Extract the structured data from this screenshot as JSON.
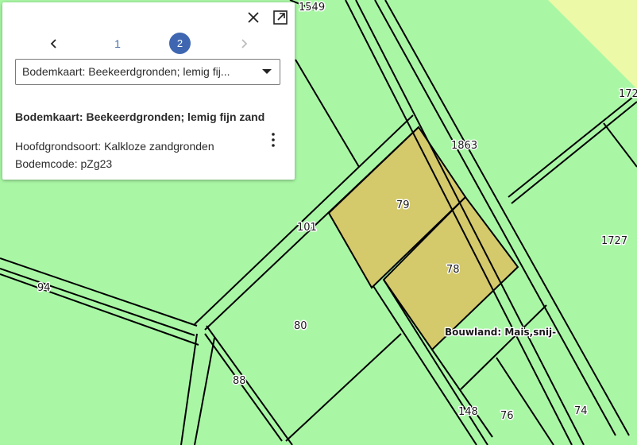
{
  "map": {
    "parcel_labels": [
      {
        "text": "1549"
      },
      {
        "text": "1863"
      },
      {
        "text": "79"
      },
      {
        "text": "78"
      },
      {
        "text": "101"
      },
      {
        "text": "94"
      },
      {
        "text": "80"
      },
      {
        "text": "88"
      },
      {
        "text": "1727"
      },
      {
        "text": "172"
      },
      {
        "text": "148"
      },
      {
        "text": "76"
      },
      {
        "text": "74"
      }
    ],
    "soil_label": "Bouwland: Mais,snij-",
    "colors": {
      "background": "#a9f7a5",
      "highlight": "#d4c96b",
      "upper_right": "#ecf9a7",
      "boundary": "#000000"
    }
  },
  "popup": {
    "pagination": {
      "page1": "1",
      "page2": "2",
      "selected": 2
    },
    "select_value": "Bodemkaart: Beekeerdgronden; lemig fij...",
    "feature_title": "Bodemkaart: Beekeerdgronden; lemig fijn zand",
    "attributes": [
      "Hoofdgrondsoort: Kalkloze zandgronden",
      "Bodemcode: pZg23"
    ],
    "icons": {
      "close": "close-icon",
      "expand": "expand-icon",
      "prev": "chevron-left-icon",
      "next": "chevron-right-icon",
      "more": "more-vertical-icon"
    }
  }
}
